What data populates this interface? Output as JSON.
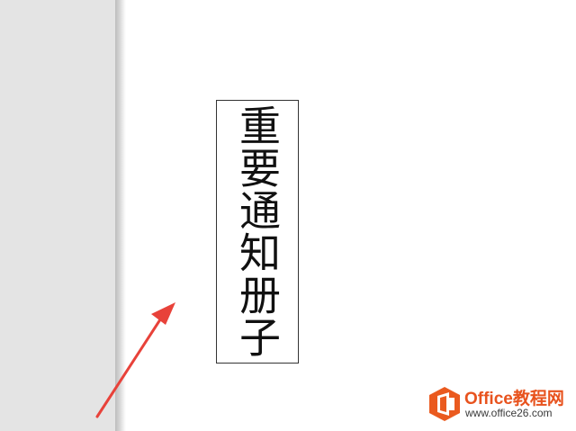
{
  "document": {
    "vertical_text": "重要通知册子"
  },
  "watermark": {
    "site_name": "Office教程网",
    "site_url": "www.office26.com",
    "logo_icon": "office-logo-icon"
  },
  "colors": {
    "margin_gray": "#e4e4e4",
    "arrow_red": "#e8423a",
    "watermark_orange": "#e8531e"
  }
}
